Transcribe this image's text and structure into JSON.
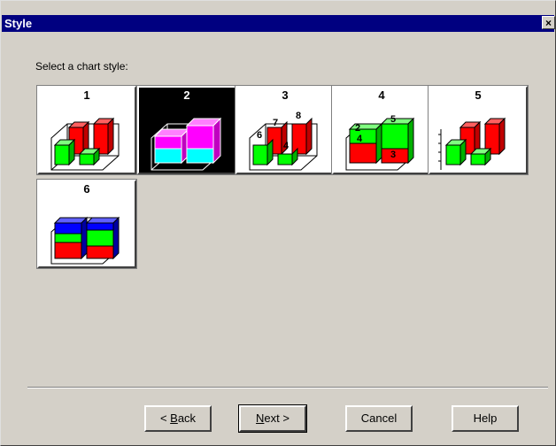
{
  "window": {
    "title": "Style",
    "close_label": "×"
  },
  "prompt": "Select a chart style:",
  "styles": [
    {
      "number": "1",
      "selected": false
    },
    {
      "number": "2",
      "selected": true
    },
    {
      "number": "3",
      "selected": false,
      "labels": [
        "7",
        "8",
        "6",
        "4"
      ]
    },
    {
      "number": "4",
      "selected": false,
      "labels": [
        "2",
        "5",
        "4",
        "3"
      ]
    },
    {
      "number": "5",
      "selected": false
    },
    {
      "number": "6",
      "selected": false
    }
  ],
  "buttons": {
    "back": {
      "prefix": "< ",
      "mnemonic": "B",
      "rest": "ack"
    },
    "next": {
      "mnemonic": "N",
      "rest": "ext >"
    },
    "cancel": "Cancel",
    "help": "Help"
  },
  "colors": {
    "titlebar": "#000080",
    "red": "#ff0000",
    "green": "#00ff00",
    "magenta": "#ff00ff",
    "cyan": "#00ffff",
    "blue": "#0000ff"
  }
}
